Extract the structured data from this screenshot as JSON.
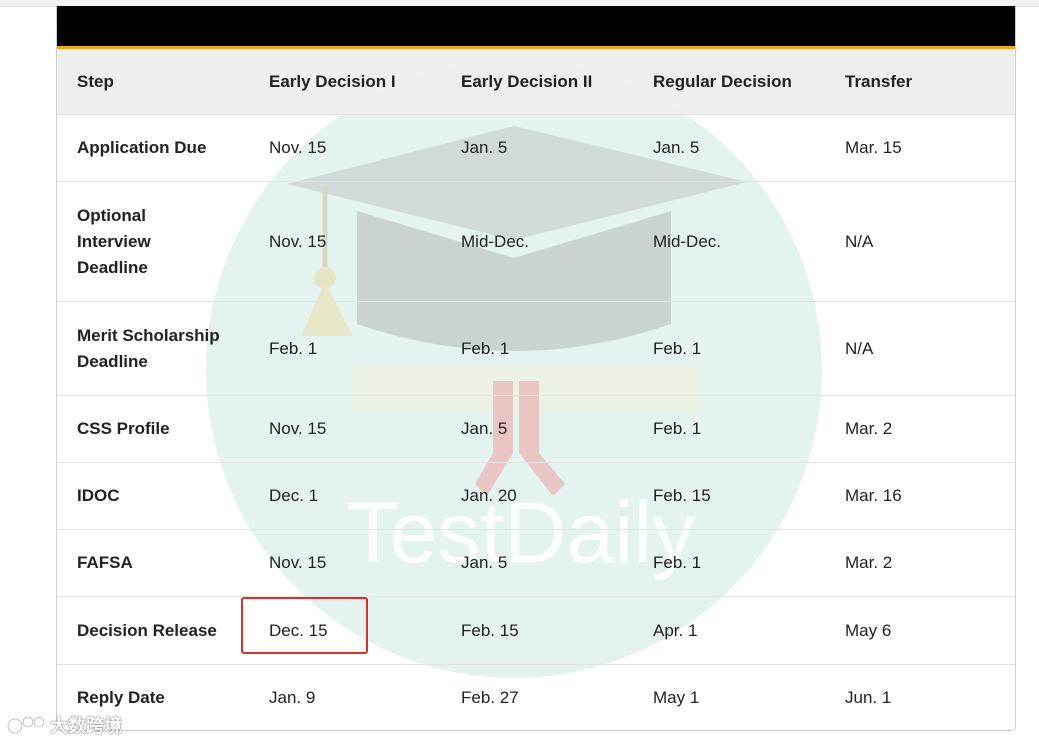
{
  "table": {
    "headers": [
      "Step",
      "Early Decision I",
      "Early Decision II",
      "Regular Decision",
      "Transfer"
    ],
    "rows": [
      {
        "step": "Application Due",
        "ed1": "Nov. 15",
        "ed2": "Jan. 5",
        "rd": "Jan. 5",
        "transfer": "Mar. 15"
      },
      {
        "step_lines": [
          "Optional",
          "Interview",
          "Deadline"
        ],
        "ed1": "Nov. 15",
        "ed2": "Mid-Dec.",
        "rd": "Mid-Dec.",
        "transfer": "N/A"
      },
      {
        "step_lines": [
          "Merit Scholarship",
          "Deadline"
        ],
        "ed1": "Feb. 1",
        "ed2": "Feb. 1",
        "rd": "Feb. 1",
        "transfer": "N/A"
      },
      {
        "step": "CSS Profile",
        "ed1": "Nov. 15",
        "ed2": "Jan. 5",
        "rd": "Feb. 1",
        "transfer": "Mar. 2"
      },
      {
        "step": "IDOC",
        "ed1": "Dec. 1",
        "ed2": "Jan. 20",
        "rd": "Feb. 15",
        "transfer": "Mar. 16"
      },
      {
        "step": "FAFSA",
        "ed1": "Nov. 15",
        "ed2": "Jan. 5",
        "rd": "Feb. 1",
        "transfer": "Mar. 2"
      },
      {
        "step": "Decision Release",
        "ed1": "Dec. 15",
        "ed2": "Feb. 15",
        "rd": "Apr. 1",
        "transfer": "May 6"
      },
      {
        "step": "Reply Date",
        "ed1": "Jan. 9",
        "ed2": "Feb. 27",
        "rd": "May 1",
        "transfer": "Jun. 1"
      }
    ]
  },
  "watermark": {
    "text": "TestDaily",
    "icon": "graduation-cap-icon"
  },
  "branding": {
    "text": "大数跨境",
    "icon": "brand-logo-icon"
  },
  "colors": {
    "header_bar": "#000000",
    "accent_line": "#f0a818",
    "highlight": "#d9312b",
    "watermark_circle": "#2ea58a"
  }
}
